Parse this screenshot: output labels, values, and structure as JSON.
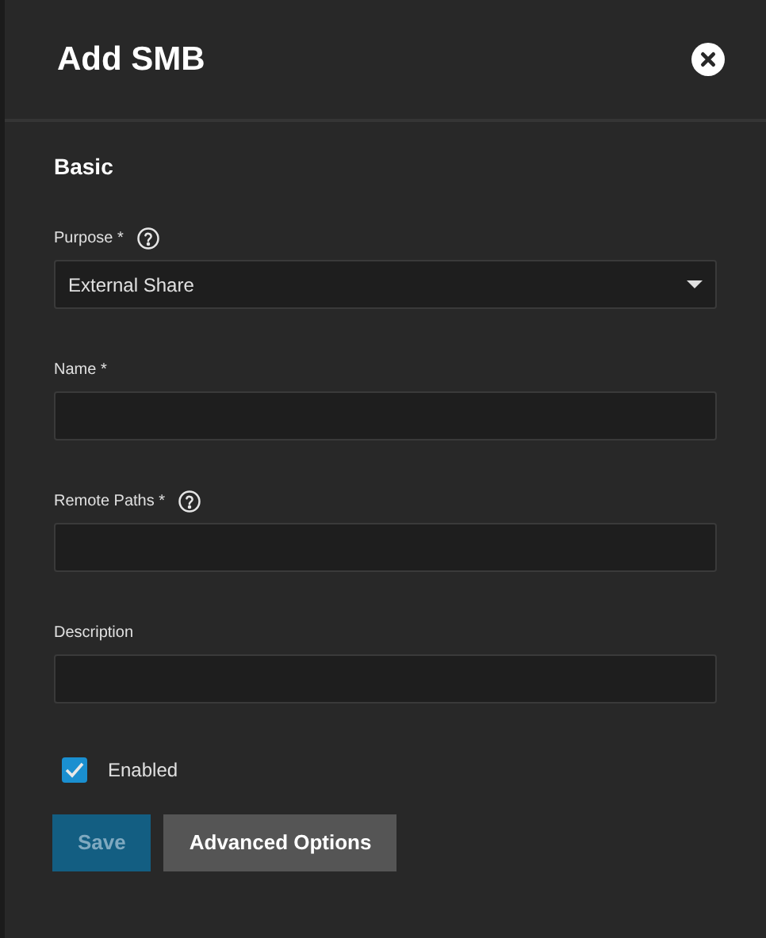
{
  "dialog": {
    "title": "Add SMB"
  },
  "section": {
    "title": "Basic"
  },
  "fields": [
    {
      "kind": "select",
      "label": "Purpose *",
      "help": true,
      "value": "External Share"
    },
    {
      "kind": "text",
      "label": "Name *",
      "help": false
    },
    {
      "kind": "text",
      "label": "Remote Paths *",
      "help": true
    },
    {
      "kind": "text",
      "label": "Description",
      "help": false
    }
  ],
  "enabled": {
    "label": "Enabled",
    "checked": true
  },
  "buttons": [
    {
      "kind": "primary",
      "label": "Save",
      "disabled": true
    },
    {
      "kind": "secondary",
      "label": "Advanced Options",
      "disabled": false
    }
  ]
}
